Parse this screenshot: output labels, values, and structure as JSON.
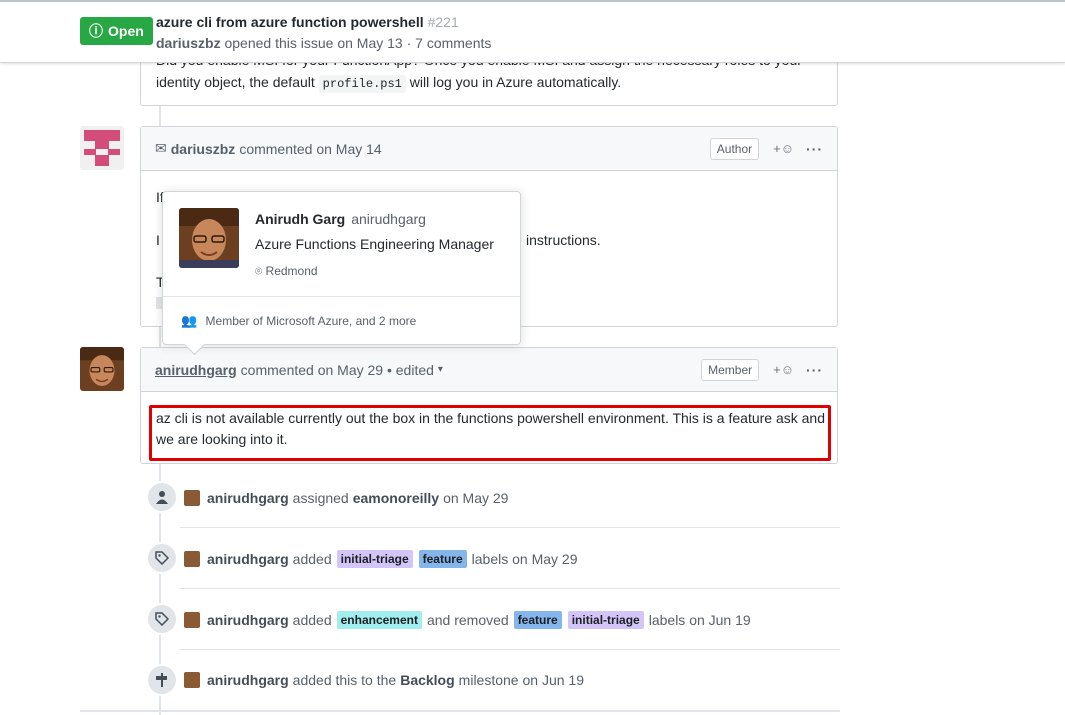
{
  "issue": {
    "state": "Open",
    "title": "azure cli from azure function powershell",
    "number": "#221",
    "author": "dariuszbz",
    "meta": "opened this issue on May 13 · 7 comments"
  },
  "first_comment": {
    "partial_line": "Did you enable MSI for your FunctionApp? Once you enable MSI and assign the necessary roles to your",
    "line2_a": "identity object, the default",
    "code": "profile.ps1",
    "line2_b": "will log you in Azure automatically."
  },
  "dariusz_comment": {
    "author": "dariuszbz",
    "action": "commented on May 14",
    "role": "Author",
    "react": "+☺",
    "more": "···",
    "visible_fragment_1": "If",
    "visible_fragment_2": "I",
    "visible_fragment_3": "instructions.",
    "visible_fragment_4": "T"
  },
  "hovercard": {
    "name": "Anirudh Garg",
    "login": "anirudhgarg",
    "bio": "Azure Functions Engineering Manager",
    "location": "Redmond",
    "membership": "Member of Microsoft Azure, and 2 more"
  },
  "anirudh_comment": {
    "author": "anirudhgarg",
    "action": "commented on May 29 • edited",
    "role": "Member",
    "react": "+☺",
    "more": "···",
    "body": "az cli is not available currently out the box in the functions powershell environment. This is a feature ask and we are looking into it."
  },
  "timeline": [
    {
      "actor": "anirudhgarg",
      "text1": "assigned",
      "bold": "eamonoreilly",
      "text2": "on May 29",
      "icon": "person-icon"
    },
    {
      "actor": "anirudhgarg",
      "text1": "added",
      "labels": [
        "initial-triage",
        "feature"
      ],
      "text2": "labels on May 29",
      "icon": "tag-icon"
    },
    {
      "actor": "anirudhgarg",
      "text1": "added",
      "labels_added": [
        "enhancement"
      ],
      "middle": "and removed",
      "labels_removed": [
        "feature",
        "initial-triage"
      ],
      "text2": "labels on Jun 19",
      "icon": "tag-icon"
    },
    {
      "actor": "anirudhgarg",
      "text1": "added this to the",
      "bold": "Backlog",
      "text2": "milestone on Jun 19",
      "icon": "milestone-icon"
    }
  ],
  "label_colors": {
    "initial-triage": "#d4c5f9",
    "feature": "#84b6eb",
    "enhancement": "#a2eeef"
  },
  "colors": {
    "open": "#28a745",
    "highlight": "#e00000"
  }
}
